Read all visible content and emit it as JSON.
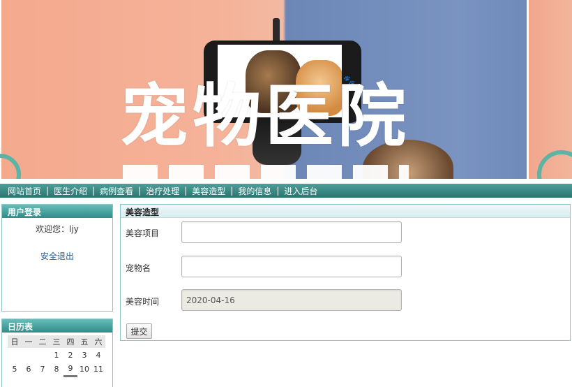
{
  "banner": {
    "title": "宠物医院"
  },
  "nav": {
    "items": [
      "网站首页",
      "医生介绍",
      "病例查看",
      "治疗处理",
      "美容造型",
      "我的信息",
      "进入后台"
    ],
    "divider": "|"
  },
  "login_panel": {
    "title": "用户登录",
    "welcome": "欢迎您：ljy",
    "logout": "安全退出"
  },
  "calendar": {
    "title": "日历表",
    "weekdays": [
      "日",
      "一",
      "二",
      "三",
      "四",
      "五",
      "六"
    ],
    "row1": [
      "",
      "",
      "",
      "1",
      "2",
      "3",
      "4"
    ],
    "row2": [
      "5",
      "6",
      "7",
      "8",
      "9",
      "10",
      "11"
    ],
    "today": "9"
  },
  "form": {
    "title": "美容造型",
    "fields": {
      "project_label": "美容项目",
      "project_value": "",
      "pet_label": "宠物名",
      "pet_value": "",
      "time_label": "美容时间",
      "time_value": "2020-04-16"
    },
    "submit": "提交"
  },
  "colors": {
    "nav_bg": "#2a7570",
    "panel_head": "#2f8c89",
    "link": "#1c5f9c"
  }
}
